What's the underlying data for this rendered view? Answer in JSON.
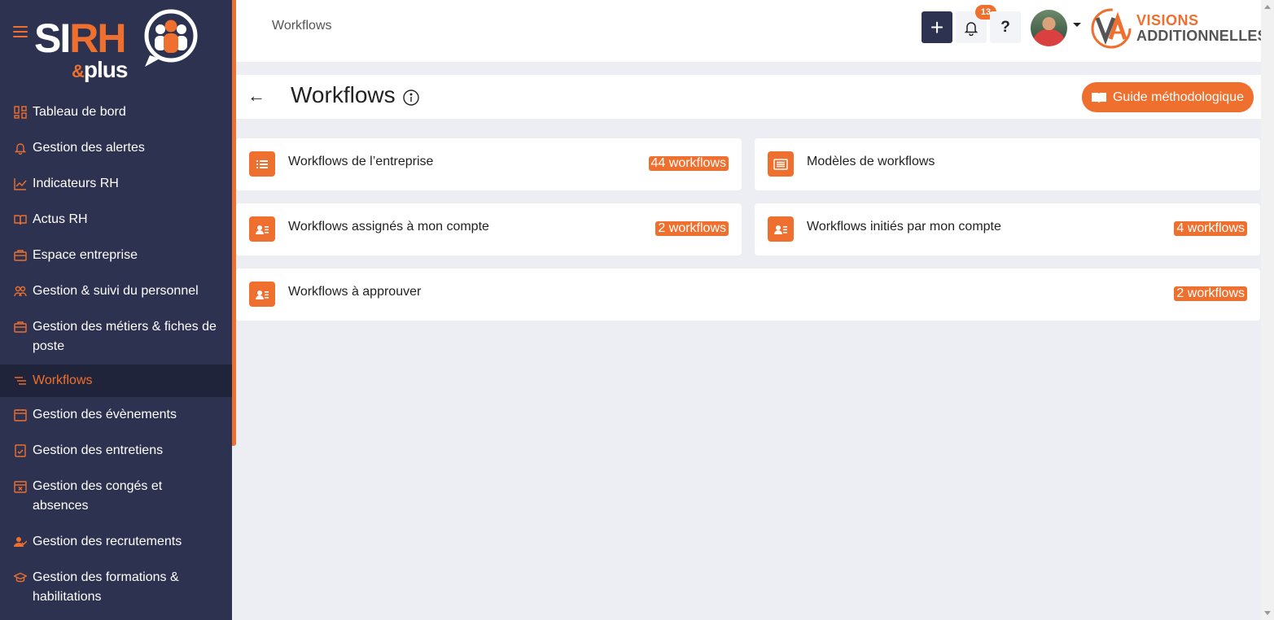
{
  "sidebar": {
    "logo": {
      "sirh": "SI",
      "rh": "RH",
      "plus": "plus",
      "amp": "&"
    },
    "items": [
      {
        "label": "Tableau de bord",
        "icon": "dashboard-icon"
      },
      {
        "label": "Gestion des alertes",
        "icon": "bell-icon"
      },
      {
        "label": "Indicateurs RH",
        "icon": "chart-line-icon"
      },
      {
        "label": "Actus RH",
        "icon": "book-open-icon"
      },
      {
        "label": "Espace entreprise",
        "icon": "briefcase-icon"
      },
      {
        "label": "Gestion & suivi du personnel",
        "icon": "users-icon"
      },
      {
        "label": "Gestion des métiers & fiches de poste",
        "icon": "briefcase-icon"
      },
      {
        "label": "Workflows",
        "icon": "workflow-lines-icon",
        "active": true
      },
      {
        "label": "Gestion des évènements",
        "icon": "calendar-icon"
      },
      {
        "label": "Gestion des entretiens",
        "icon": "checklist-icon"
      },
      {
        "label": "Gestion des congés et absences",
        "icon": "calendar-x-icon"
      },
      {
        "label": "Gestion des recrutements",
        "icon": "user-check-icon"
      },
      {
        "label": "Gestion des formations & habilitations",
        "icon": "graduation-cap-icon"
      }
    ]
  },
  "header": {
    "breadcrumb": "Workflows",
    "notifications_count": "13",
    "help_label": "?",
    "brand_line1": "VISIONS",
    "brand_line2": "ADDITIONNELLES"
  },
  "title": {
    "text": "Workflows",
    "guide_button": "Guide méthodologique"
  },
  "cards": [
    {
      "label": "Workflows de l’entreprise",
      "badge": "44 workflows",
      "icon": "list-icon"
    },
    {
      "label": "Modèles de workflows",
      "badge": "",
      "icon": "template-list-icon"
    },
    {
      "label": "Workflows assignés à mon compte",
      "badge": "2 workflows",
      "icon": "contact-card-icon"
    },
    {
      "label": "Workflows initiés par mon compte",
      "badge": "4 workflows",
      "icon": "contact-card-icon"
    },
    {
      "label": "Workflows à approuver",
      "badge": "2 workflows",
      "icon": "contact-card-icon"
    }
  ],
  "colors": {
    "accent": "#ef6f2e",
    "sidebar_bg": "#2c3250",
    "sidebar_active_bg": "#20243a",
    "page_bg": "#eceef4"
  }
}
